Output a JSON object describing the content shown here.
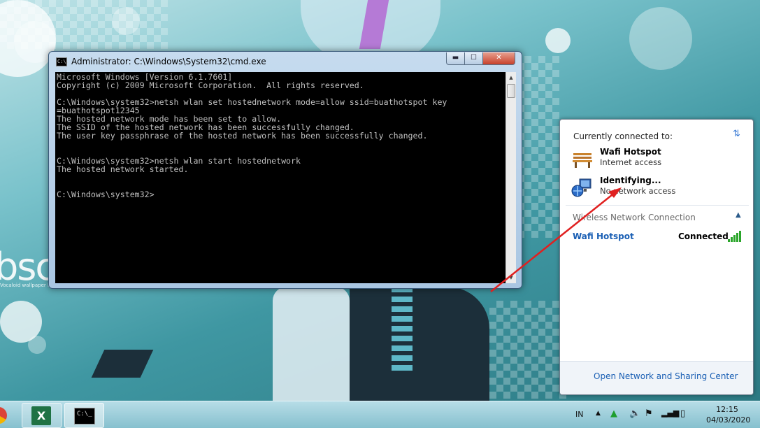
{
  "cmd": {
    "title": "Administrator: C:\\Windows\\System32\\cmd.exe",
    "icon_label": "C:\\.",
    "output": "Microsoft Windows [Version 6.1.7601]\nCopyright (c) 2009 Microsoft Corporation.  All rights reserved.\n\nC:\\Windows\\system32>netsh wlan set hostednetwork mode=allow ssid=buathotspot key\n=buathotspot12345\nThe hosted network mode has been set to allow.\nThe SSID of the hosted network has been successfully changed.\nThe user key passphrase of the hosted network has been successfully changed.\n\n\nC:\\Windows\\system32>netsh wlan start hostednetwork\nThe hosted network started.\n\n\nC:\\Windows\\system32>",
    "buttons": {
      "minimize": "▬",
      "maximize": "☐",
      "close": "✕"
    }
  },
  "network_popup": {
    "header": "Currently connected to:",
    "connections": [
      {
        "name": "Wafi Hotspot",
        "status": "Internet access",
        "icon": "bench-network-icon"
      },
      {
        "name": "Identifying...",
        "status": "No network access",
        "icon": "unidentified-network-icon"
      }
    ],
    "section_title": "Wireless Network Connection",
    "wifi": {
      "name": "Wafi Hotspot",
      "state": "Connected",
      "signal_bars": 5
    },
    "footer_link": "Open Network and Sharing Center"
  },
  "wallpaper": {
    "logo_text": "bsc",
    "caption": "Vocaloid wallpaper l"
  },
  "taskbar": {
    "apps": [
      {
        "name": "Google Chrome",
        "icon": "chrome-icon"
      },
      {
        "name": "Microsoft Excel",
        "icon": "excel-icon",
        "glyph": "X"
      },
      {
        "name": "Command Prompt",
        "icon": "cmd-icon",
        "glyph": "C:\\_"
      }
    ],
    "tray": {
      "language": "IN",
      "chevron": "▲",
      "time": "12:15",
      "date": "04/03/2020"
    }
  },
  "colors": {
    "link_blue": "#1a5fb4",
    "signal_green": "#2aa52a",
    "annotation_red": "#e02020"
  }
}
